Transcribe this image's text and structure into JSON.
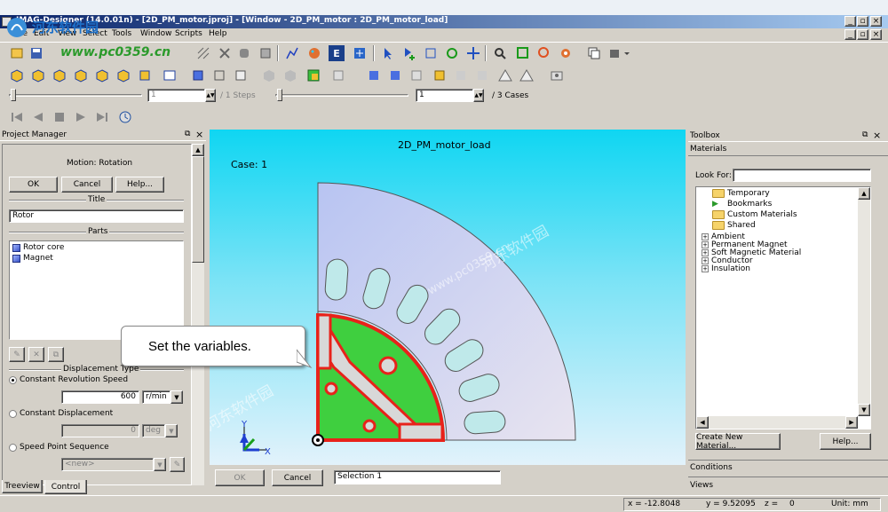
{
  "window": {
    "title": "JMAG-Designer (14.0.01n) - [2D_PM_motor.jproj] - [Window - 2D_PM_motor : 2D_PM_motor_load]",
    "title_icon": "jmag-app-icon"
  },
  "menu": [
    "File",
    "Edit",
    "View",
    "Select",
    "Tools",
    "Window",
    "Scripts",
    "Help"
  ],
  "watermark": {
    "logo_text": "河东软件园",
    "url": "www.pc0359.cn"
  },
  "steps_bar": {
    "steps_value": "1",
    "steps_label": "/ 1 Steps",
    "cases_value": "1",
    "cases_label": "/ 3 Cases"
  },
  "project_manager": {
    "title": "Project Manager",
    "motion_label": "Motion: Rotation",
    "ok": "OK",
    "cancel": "Cancel",
    "help": "Help...",
    "title_section": "Title",
    "title_value": "Rotor",
    "parts_section": "Parts",
    "parts": [
      "Rotor core",
      "Magnet"
    ],
    "displacement_section": "Displacement Type",
    "opt_constant_speed": "Constant Revolution Speed",
    "speed_value": "600",
    "speed_unit": "r/min",
    "opt_constant_disp": "Constant Displacement",
    "disp_value": "0",
    "disp_unit": "deg",
    "opt_speed_points": "Speed Point Sequence",
    "speed_points_value": "<new>",
    "tabs": [
      "Treeview",
      "Control"
    ]
  },
  "callout": {
    "text": "Set the variables."
  },
  "viewport": {
    "title": "2D_PM_motor_load",
    "case_label": "Case: 1",
    "axis_x": "X",
    "axis_y": "Y",
    "bg_top": "#0fd6f2",
    "bg_bottom": "#e2f2fb",
    "part_color": "#3fcf3f",
    "outline_color": "#e8221a"
  },
  "viewport_bottom": {
    "ok": "OK",
    "cancel": "Cancel",
    "selection": "Selection 1"
  },
  "toolbox": {
    "title": "Toolbox",
    "materials": "Materials",
    "look_for": "Look For:",
    "folders": [
      "Temporary",
      "Bookmarks",
      "Custom Materials",
      "Shared"
    ],
    "categories": [
      "Ambient",
      "Permanent Magnet",
      "Soft Magnetic Material",
      "Conductor",
      "Insulation"
    ],
    "create_btn": "Create New Material...",
    "help_btn": "Help...",
    "conditions": "Conditions",
    "views": "Views"
  },
  "status": {
    "x": "x = -12.8048",
    "y": "y = 9.52095",
    "z_label": "z =",
    "z_value": "0",
    "unit": "Unit: mm"
  }
}
